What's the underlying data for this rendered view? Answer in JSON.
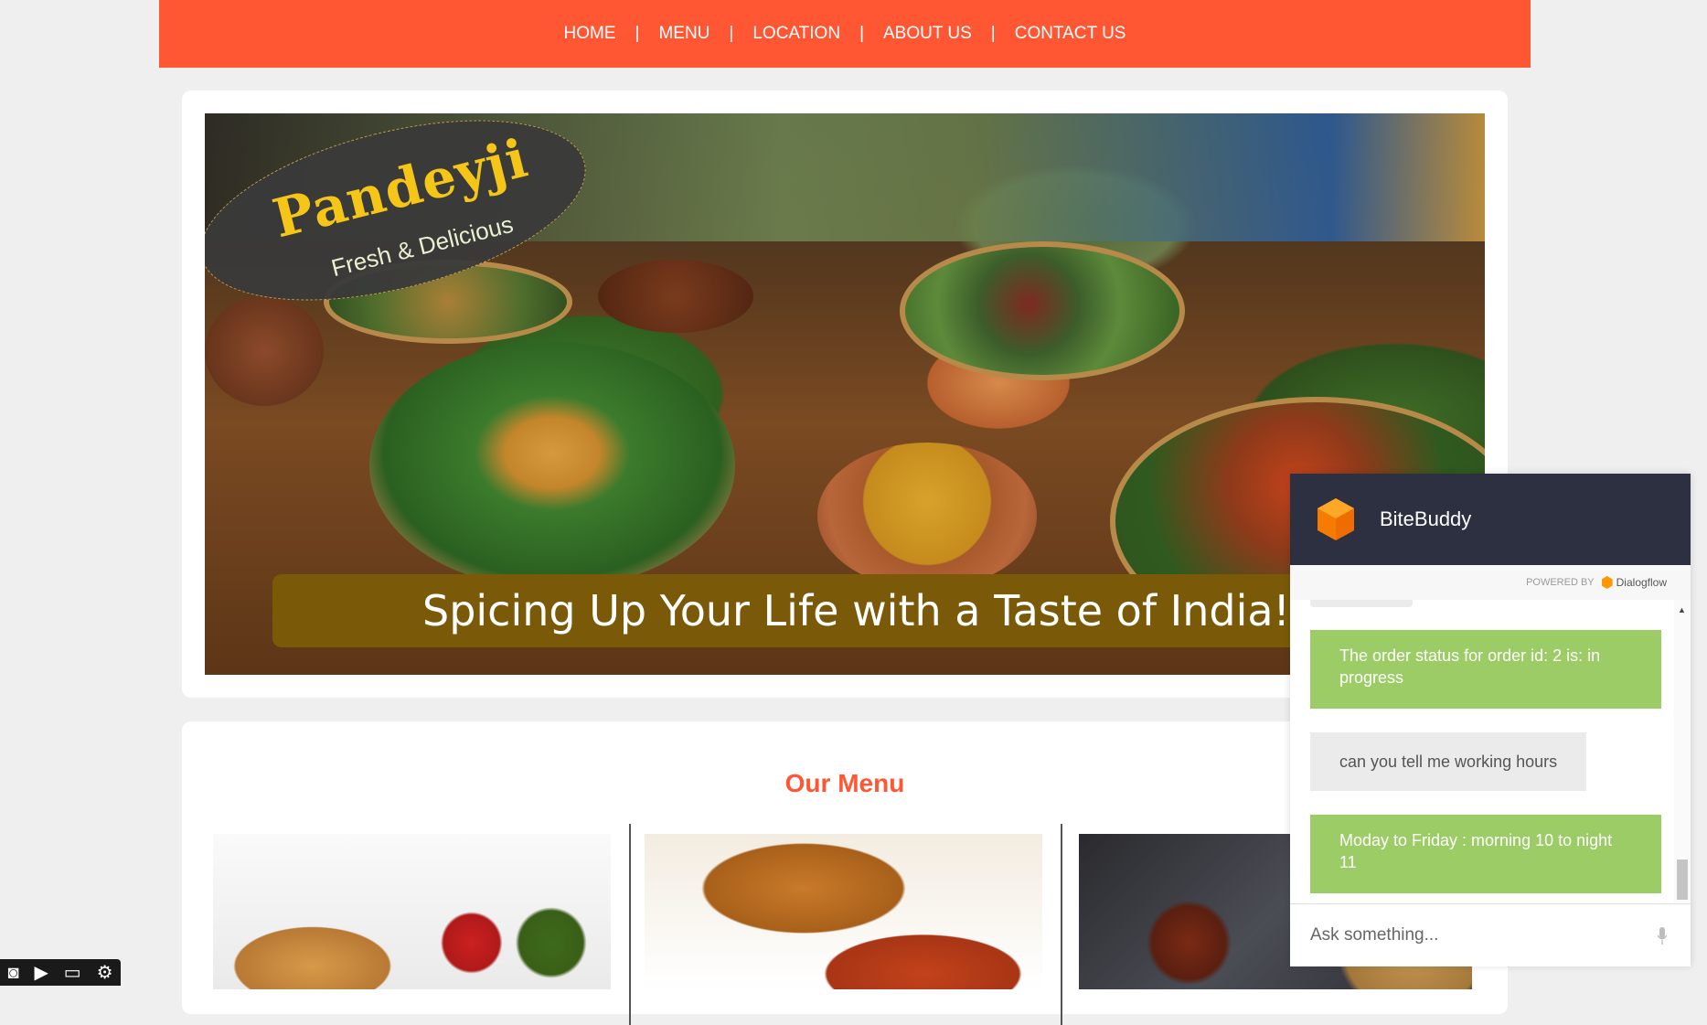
{
  "nav": {
    "items": [
      "HOME",
      "MENU",
      "LOCATION",
      "ABOUT US",
      "CONTACT US"
    ],
    "separator": "|"
  },
  "hero": {
    "logo_title": "Pandeyji",
    "logo_subtitle": "Fresh & Delicious",
    "tagline": "Spicing Up Your Life with a Taste of India!"
  },
  "menu": {
    "title": "Our Menu"
  },
  "chat": {
    "title": "BiteBuddy",
    "powered_by": "POWERED BY",
    "powered_brand": "Dialogflow",
    "messages": [
      {
        "from": "bot",
        "text": "The order status for order id: 2 is: in progress"
      },
      {
        "from": "user",
        "text": "can you tell me working hours"
      },
      {
        "from": "bot",
        "text": "Moday to Friday : morning 10 to night 11"
      }
    ],
    "input_placeholder": "Ask something..."
  },
  "colors": {
    "brand": "#ff5733",
    "chat_header": "#2c3040",
    "bot_bubble": "#9ccc65",
    "tagline_bar": "#7a5a08"
  },
  "toolbar": {
    "icons": [
      "camera-icon",
      "video-icon",
      "window-icon",
      "gear-icon"
    ]
  }
}
